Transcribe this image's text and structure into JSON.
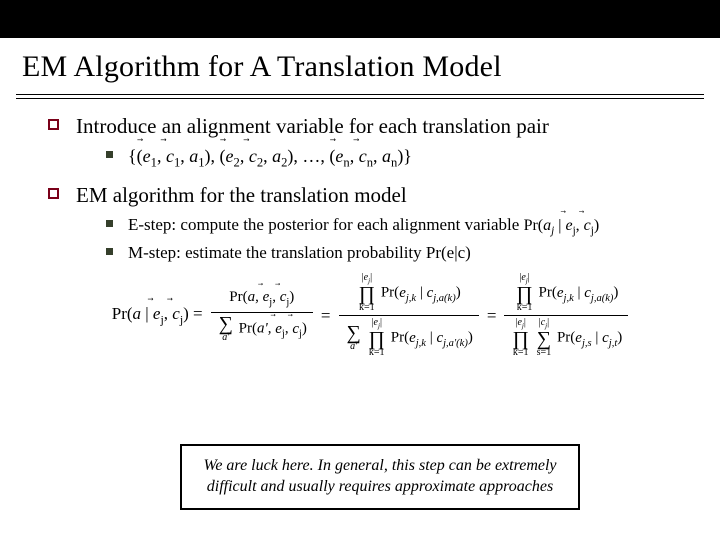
{
  "title": "EM Algorithm for A Translation Model",
  "bullets": {
    "b1": "Introduce an alignment variable for each translation pair",
    "b1_formula_tex": "\\{(\\vec{e}_1,\\vec{c}_1,a_1),(\\vec{e}_2,\\vec{c}_2,a_2),\\ldots,(\\vec{e}_n,\\vec{c}_n,a_n)\\}",
    "b2": "EM algorithm for the translation model",
    "b2_sub1_prefix": "E-step: compute the posterior for each alignment variable ",
    "b2_sub1_formula_tex": "\\Pr(a_j \\mid \\vec{e}_j, \\vec{c}_j)",
    "b2_sub2": "M-step: estimate the translation probability Pr(e|c)"
  },
  "equation_tex": "\\Pr(a \\mid \\vec{e}_j, \\vec{c}_j) = \\frac{\\Pr(a, \\vec{e}_j, \\vec{c}_j)}{\\sum_{a'} \\Pr(a', \\vec{e}_j, \\vec{c}_j)} = \\frac{\\prod_{k=1}^{|e_j|} \\Pr(e_{j,k} \\mid c_{j,a(k)})}{\\sum_{a'} \\prod_{k=1}^{|e_j|} \\Pr(e_{j,k} \\mid c_{j,a'(k)})} = \\frac{\\prod_{k=1}^{|e_j|} \\Pr(e_{j,k} \\mid c_{j,a(k)})}{\\prod_{k=1}^{|e_j|} \\sum_{s=1}^{|c_j|} \\Pr(e_{j,s} \\mid c_{j,t})}",
  "callout": "We are luck here. In general, this step can be extremely difficult and usually requires approximate approaches"
}
